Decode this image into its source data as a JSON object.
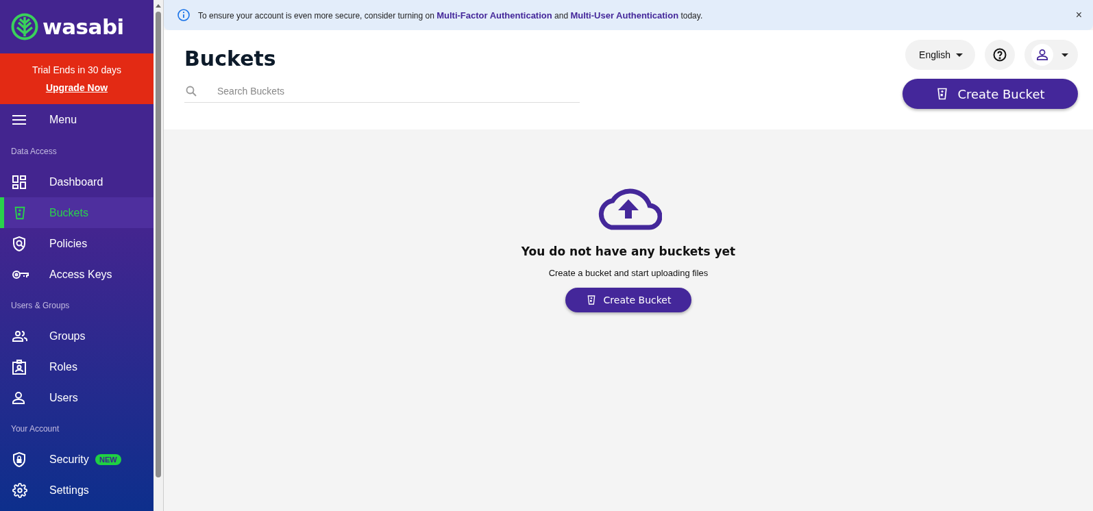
{
  "brand": {
    "name": "wasabi"
  },
  "trial": {
    "message": "Trial Ends in 30 days",
    "link": "Upgrade Now"
  },
  "sidebar": {
    "menu_label": "Menu",
    "items": [
      {
        "kind": "section",
        "label": "Data Access"
      },
      {
        "kind": "link",
        "label": "Dashboard",
        "selected": false
      },
      {
        "kind": "link",
        "label": "Buckets",
        "selected": true
      },
      {
        "kind": "link",
        "label": "Policies",
        "selected": false
      },
      {
        "kind": "link",
        "label": "Access Keys",
        "selected": false
      },
      {
        "kind": "section",
        "label": "Users & Groups"
      },
      {
        "kind": "link",
        "label": "Groups",
        "selected": false
      },
      {
        "kind": "link",
        "label": "Roles",
        "selected": false
      },
      {
        "kind": "link",
        "label": "Users",
        "selected": false
      },
      {
        "kind": "section",
        "label": "Your Account"
      },
      {
        "kind": "link",
        "label": "Security",
        "selected": false,
        "badge": "NEW"
      },
      {
        "kind": "link",
        "label": "Settings",
        "selected": false
      }
    ]
  },
  "banner": {
    "message": "To ensure your account is even more secure, consider turning on **Multi-Factor Authentication** and **Multi-User Authentication** today.",
    "close": "×"
  },
  "header": {
    "title": "Buckets",
    "search": {
      "placeholder": "Search Buckets"
    },
    "language": "English",
    "create_button": "Create Bucket"
  },
  "empty_state": {
    "title": "You do not have any buckets yet",
    "subtitle": "Create a bucket and start uploading files",
    "button": "Create Bucket"
  }
}
